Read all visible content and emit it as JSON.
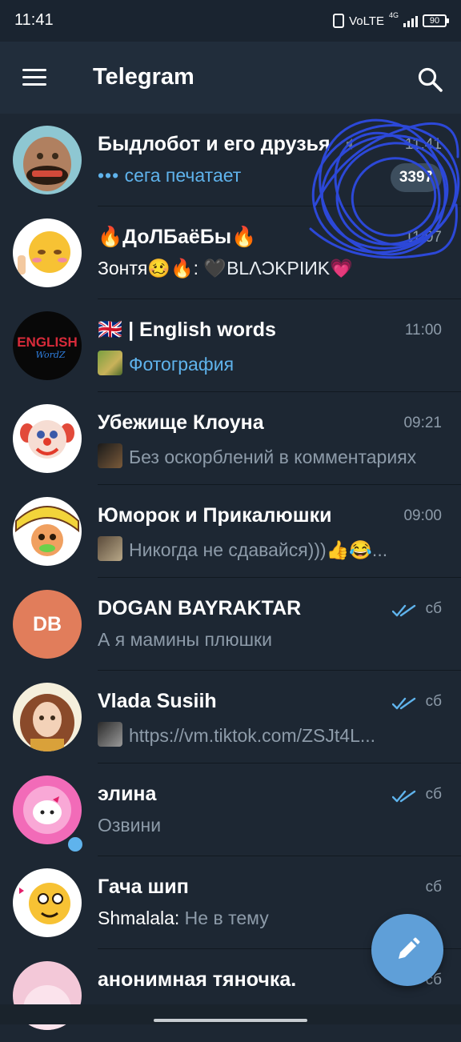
{
  "status_bar": {
    "time": "11:41",
    "network": "VoLTE",
    "network_type": "4G",
    "battery": "90"
  },
  "header": {
    "title": "Telegram"
  },
  "colors": {
    "background": "#1d2733",
    "header": "#212d3b",
    "accent_blue": "#5fb3ec",
    "unread_badge": "#3d4e5e",
    "fab": "#5f9fd8",
    "scribble": "#2c48d8"
  },
  "chats": [
    {
      "title": "Быдлобот и его друзья",
      "time": "11:41",
      "muted": true,
      "typing_dots": "•••",
      "preview": "сега печатает",
      "unread": "3397"
    },
    {
      "title": "🔥ДоЛБаёБы🔥",
      "time": "11:07",
      "preview_sender": "Зонтя🥴🔥:",
      "preview": " 🖤BLΛƆKPIИK💗"
    },
    {
      "title": "🇬🇧 | English words",
      "time": "11:00",
      "preview": "Фотография",
      "avatar_text": "ENGLISH",
      "avatar_subtext": "WordZ"
    },
    {
      "title": "Убежище Клоуна",
      "time": "09:21",
      "preview": "Без оскорблений в комментариях"
    },
    {
      "title": "Юморок и Прикалюшки",
      "time": "09:00",
      "preview": "Никогда не сдавайся)))👍😂..."
    },
    {
      "title": "DOGAN BAYRAKTAR",
      "time": "сб",
      "preview": "А я мамины плюшки",
      "initials": "DB"
    },
    {
      "title": "Vlada Susiih",
      "time": "сб",
      "preview": "https://vm.tiktok.com/ZSJt4L..."
    },
    {
      "title": "элина",
      "time": "сб",
      "preview": "Озвини",
      "online": true
    },
    {
      "title": "Гача шип",
      "time": "сб",
      "preview_sender": "Shmalala:",
      "preview": " Не в тему"
    },
    {
      "title": "анонимная тяночка.",
      "time": "сб",
      "preview": ""
    }
  ]
}
